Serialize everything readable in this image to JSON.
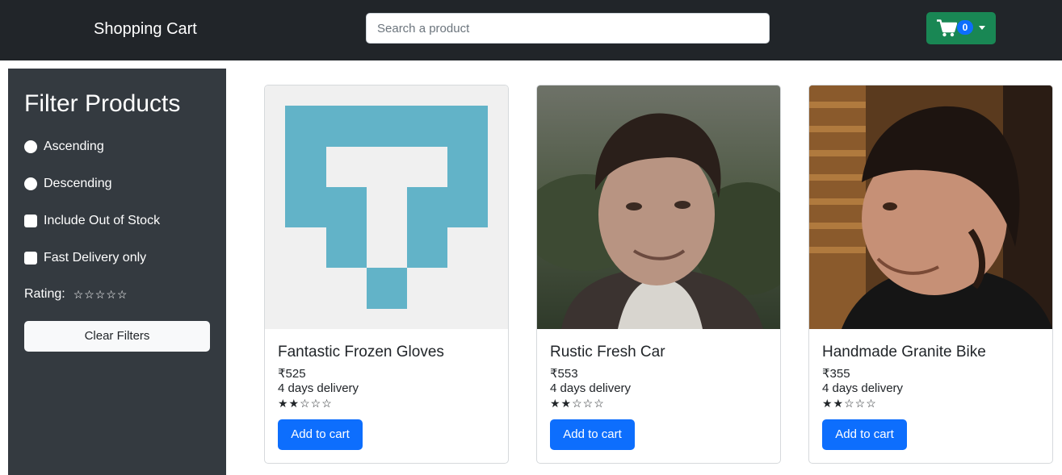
{
  "navbar": {
    "brand": "Shopping Cart",
    "search_placeholder": "Search a product",
    "search_value": "",
    "cart_count": "0",
    "cart_icon": "shopping-cart-icon",
    "colors": {
      "navbar_bg": "#212529",
      "cart_button": "#198754",
      "badge": "#0d6efd"
    }
  },
  "sidebar": {
    "title": "Filter Products",
    "options": [
      {
        "label": "Ascending",
        "type": "radio",
        "checked": false
      },
      {
        "label": "Descending",
        "type": "radio",
        "checked": false
      },
      {
        "label": "Include Out of Stock",
        "type": "checkbox",
        "checked": false
      },
      {
        "label": "Fast Delivery only",
        "type": "checkbox",
        "checked": false
      }
    ],
    "rating_label": "Rating:",
    "rating_stars": "☆☆☆☆☆",
    "rating_value": 0,
    "clear_label": "Clear Filters"
  },
  "products": [
    {
      "title": "Fantastic Frozen Gloves",
      "price": "₹525",
      "delivery": "4 days delivery",
      "stars": "★★☆☆☆",
      "rating": 2,
      "button": "Add to cart",
      "image": "identicon-placeholder"
    },
    {
      "title": "Rustic Fresh Car",
      "price": "₹553",
      "delivery": "4 days delivery",
      "stars": "★★☆☆☆",
      "rating": 2,
      "button": "Add to cart",
      "image": "person-photo"
    },
    {
      "title": "Handmade Granite Bike",
      "price": "₹355",
      "delivery": "4 days delivery",
      "stars": "★★☆☆☆",
      "rating": 2,
      "button": "Add to cart",
      "image": "person-photo"
    }
  ]
}
